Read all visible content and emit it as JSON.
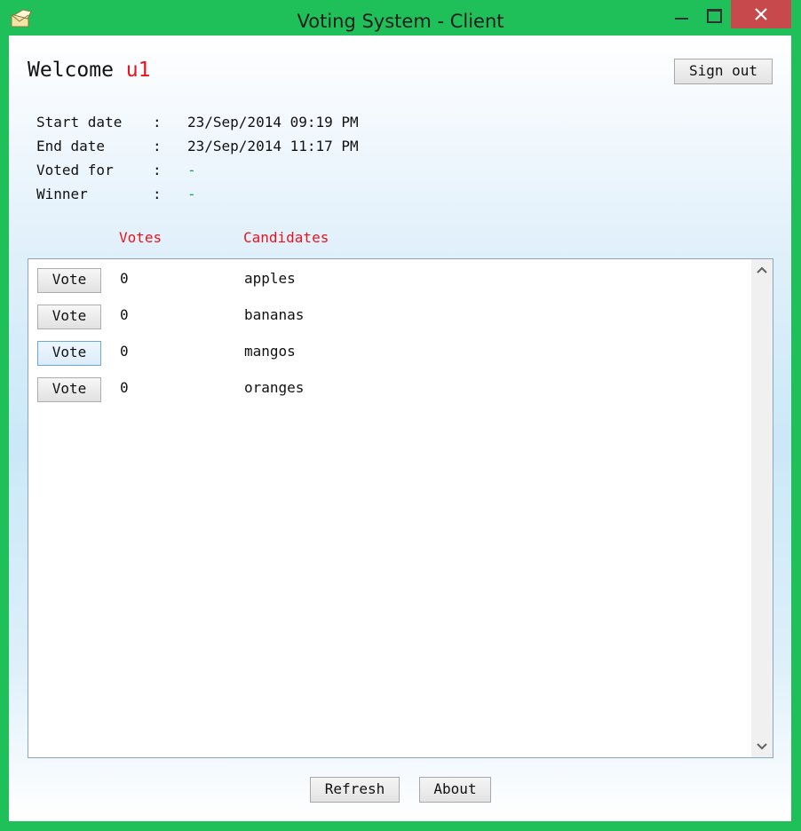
{
  "window": {
    "title": "Voting System - Client",
    "frame_color": "#1fc05a",
    "close_color": "#c7494c"
  },
  "header": {
    "welcome_label": "Welcome",
    "username": "u1",
    "signout_label": "Sign out"
  },
  "info": [
    {
      "label": "Start date",
      "value": "23/Sep/2014 09:19 PM"
    },
    {
      "label": "End date",
      "value": "23/Sep/2014 11:17 PM"
    },
    {
      "label": "Voted for",
      "value": "-"
    },
    {
      "label": "Winner",
      "value": "-"
    }
  ],
  "colon": ":",
  "columns": {
    "votes": "Votes",
    "candidates": "Candidates"
  },
  "candidates": [
    {
      "vote_label": "Vote",
      "votes": "0",
      "name": "apples"
    },
    {
      "vote_label": "Vote",
      "votes": "0",
      "name": "bananas"
    },
    {
      "vote_label": "Vote",
      "votes": "0",
      "name": "mangos"
    },
    {
      "vote_label": "Vote",
      "votes": "0",
      "name": "oranges"
    }
  ],
  "footer": {
    "refresh_label": "Refresh",
    "about_label": "About"
  },
  "icons": {
    "app": "envelope-icon",
    "scroll_up": "chevron-up-icon",
    "scroll_down": "chevron-down-icon"
  }
}
